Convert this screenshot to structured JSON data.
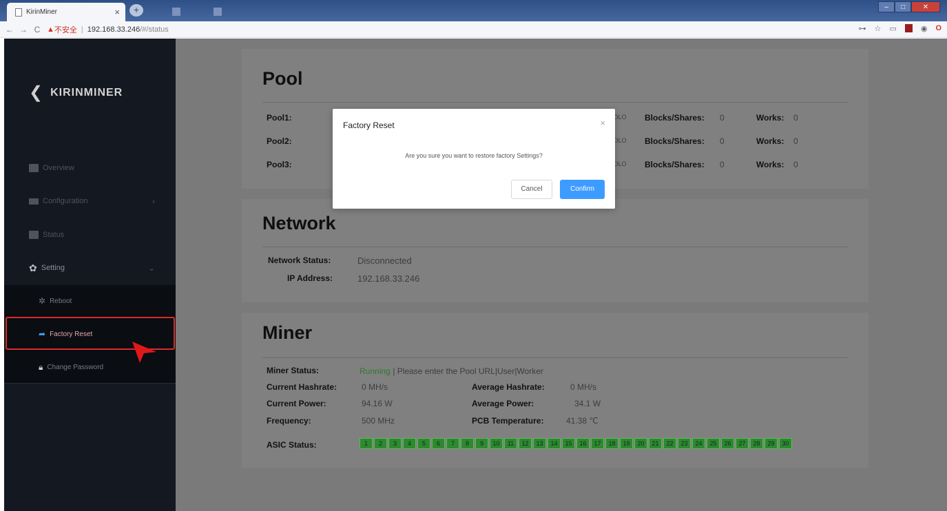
{
  "browser": {
    "tab_title": "KirinMiner",
    "tab_close": "×",
    "new_tab": "+",
    "url_insecure": "不安全",
    "url_host": "192.168.33.246",
    "url_path": "/#/status"
  },
  "sidebar": {
    "logo": "KIRINMINER",
    "items": [
      {
        "label": "Overview"
      },
      {
        "label": "Configuration"
      },
      {
        "label": "Status"
      },
      {
        "label": "Setting"
      }
    ],
    "submenu": [
      {
        "label": "Reboot"
      },
      {
        "label": "Factory Reset"
      },
      {
        "label": "Change Password"
      }
    ]
  },
  "pool": {
    "title": "Pool",
    "rows": [
      {
        "label": "Pool1:",
        "partial": "DLO",
        "blocks_label": "Blocks/Shares:",
        "blocks_value": "0",
        "works_label": "Works:",
        "works_value": "0"
      },
      {
        "label": "Pool2:",
        "partial": "DLO",
        "blocks_label": "Blocks/Shares:",
        "blocks_value": "0",
        "works_label": "Works:",
        "works_value": "0"
      },
      {
        "label": "Pool3:",
        "partial": "DLO",
        "blocks_label": "Blocks/Shares:",
        "blocks_value": "0",
        "works_label": "Works:",
        "works_value": "0"
      }
    ]
  },
  "network": {
    "title": "Network",
    "status_label": "Network Status:",
    "status_value": "Disconnected",
    "ip_label": "IP Address:",
    "ip_value": "192.168.33.246"
  },
  "miner": {
    "title": "Miner",
    "status_label": "Miner Status:",
    "status_running": "Running",
    "status_message": "| Please enter the Pool URL|User|Worker",
    "hashrate_label": "Current Hashrate:",
    "hashrate_value": "0 MH/s",
    "avg_hashrate_label": "Average Hashrate:",
    "avg_hashrate_value": "0 MH/s",
    "power_label": "Current Power:",
    "power_value": "94.16 W",
    "avg_power_label": "Average Power:",
    "avg_power_value": "34.1 W",
    "freq_label": "Frequency:",
    "freq_value": "500 MHz",
    "pcb_label": "PCB Temperature:",
    "pcb_value": "41.38 ℃",
    "asic_label": "ASIC Status:",
    "asic_chips": [
      "1",
      "2",
      "3",
      "4",
      "5",
      "6",
      "7",
      "8",
      "9",
      "10",
      "11",
      "12",
      "13",
      "14",
      "15",
      "16",
      "17",
      "18",
      "19",
      "20",
      "21",
      "22",
      "23",
      "24",
      "25",
      "26",
      "27",
      "28",
      "29",
      "30"
    ]
  },
  "modal": {
    "title": "Factory Reset",
    "close": "×",
    "message": "Are you sure you want to restore factory Settings?",
    "cancel": "Cancel",
    "confirm": "Confirm"
  },
  "colors": {
    "accent": "#3d9bff",
    "chip_ok": "#2d8a2d",
    "highlight": "#d92b2b"
  }
}
